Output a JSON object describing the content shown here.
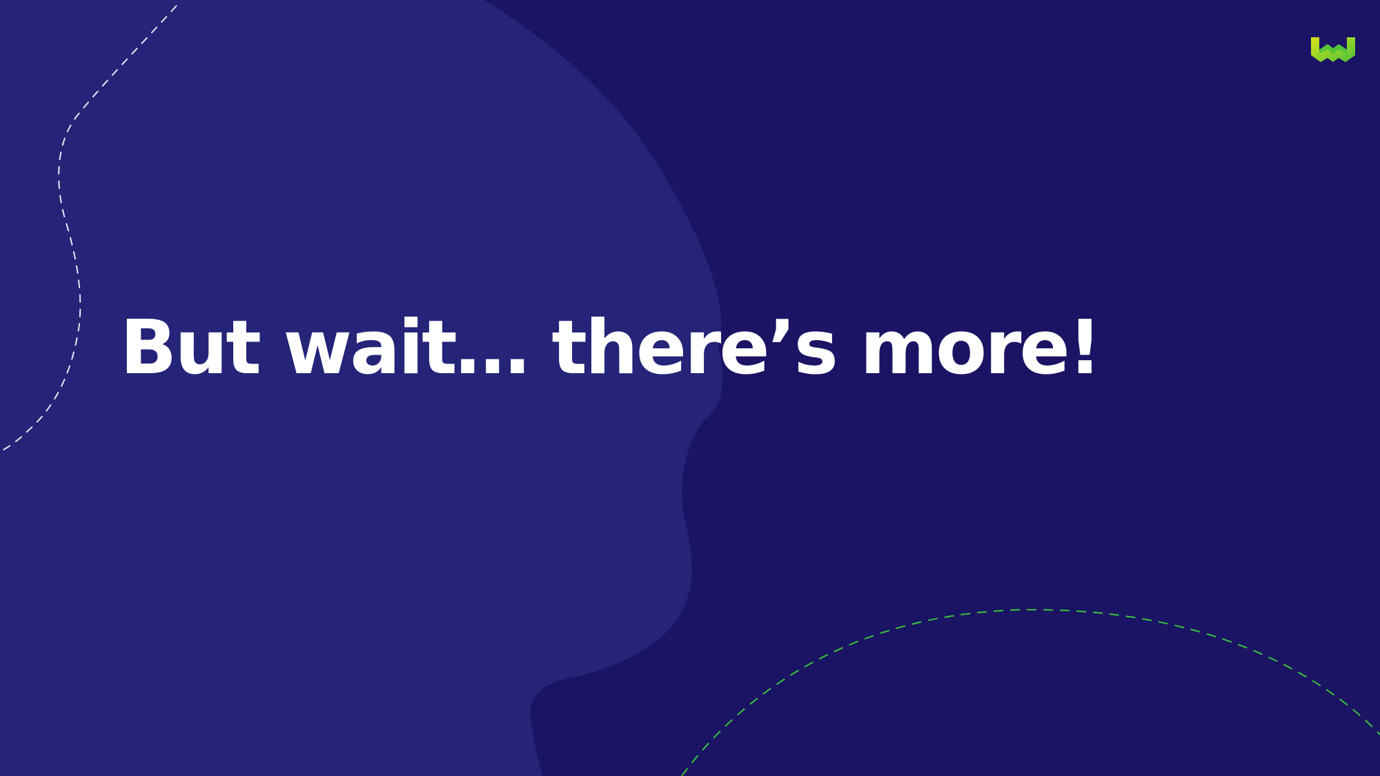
{
  "slide": {
    "headline": "But wait… there’s more!"
  },
  "colors": {
    "background": "#1b1464",
    "blob": "#252479",
    "text": "#ffffff",
    "dashed_line_light": "#e8e8f0",
    "dashed_line_green": "#39c43c",
    "logo_green": "#49c23a",
    "logo_yellow": "#dce21a"
  },
  "icons": {
    "logo": "brand-w-logo-icon"
  }
}
